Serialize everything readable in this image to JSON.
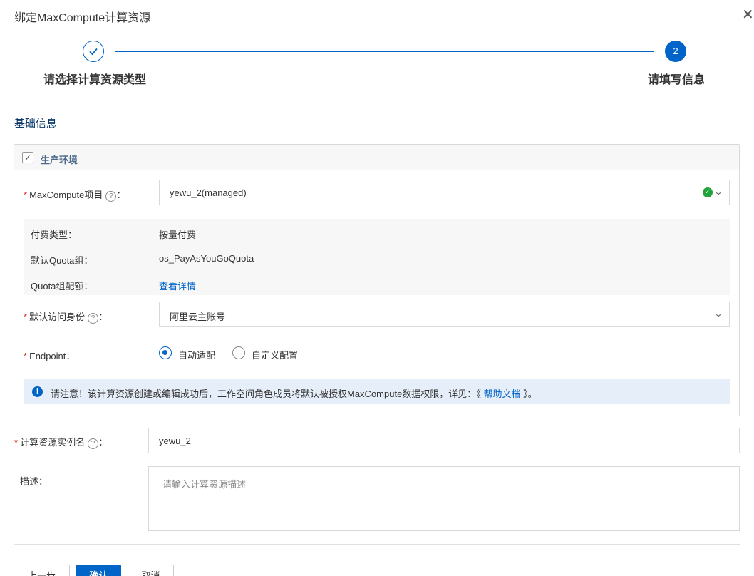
{
  "dialog": {
    "title": "绑定MaxCompute计算资源",
    "close_icon": "close-icon"
  },
  "steps": [
    {
      "label": "请选择计算资源类型",
      "state": "done",
      "icon": "check-icon"
    },
    {
      "label": "请填写信息",
      "state": "active",
      "number": "2"
    }
  ],
  "section_title": "基础信息",
  "panel": {
    "title": "生产环境",
    "checked": true
  },
  "form": {
    "project": {
      "label": "MaxCompute项目",
      "colon": "：",
      "value": "yewu_2(managed)",
      "status_icon": "check-circle-icon"
    },
    "info": [
      {
        "key": "付费类型：",
        "value": "按量付费"
      },
      {
        "key": "默认Quota组：",
        "value": "os_PayAsYouGoQuota"
      },
      {
        "key": "Quota组配额：",
        "link": "查看详情"
      }
    ],
    "identity": {
      "label": "默认访问身份",
      "colon": "：",
      "value": "阿里云主账号"
    },
    "endpoint": {
      "label": "Endpoint：",
      "options": [
        {
          "label": "自动适配",
          "selected": true
        },
        {
          "label": "自定义配置",
          "selected": false
        }
      ]
    },
    "notice": {
      "icon": "info-icon",
      "text": "请注意！该计算资源创建或编辑成功后，工作空间角色成员将默认被授权MaxCompute数据权限，详见：",
      "link_prefix": "《",
      "link": " 帮助文档 ",
      "link_suffix": "》。"
    },
    "instance_name": {
      "label": "计算资源实例名",
      "colon": "：",
      "value": "yewu_2"
    },
    "description": {
      "label": "描述：",
      "placeholder": "请输入计算资源描述"
    }
  },
  "buttons": {
    "prev": "上一步",
    "confirm": "确认",
    "cancel": "取消"
  },
  "colors": {
    "primary": "#0064c8",
    "required": "#d93026",
    "success": "#23a33d"
  }
}
